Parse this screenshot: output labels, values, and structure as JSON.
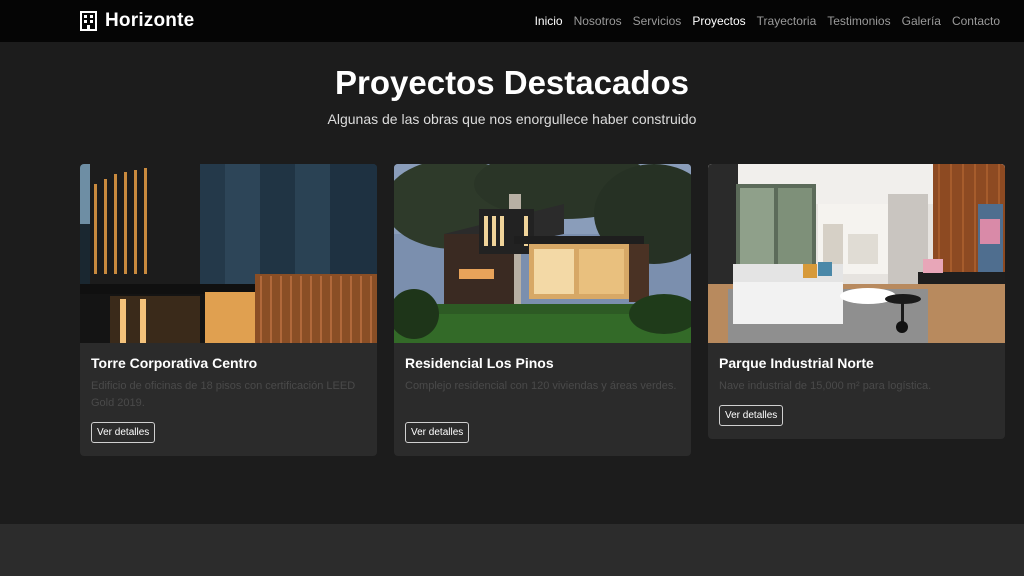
{
  "nav": {
    "brand": "Horizonte",
    "brand_icon": "building-icon",
    "links": [
      {
        "label": "Inicio",
        "state": "active"
      },
      {
        "label": "Nosotros",
        "state": ""
      },
      {
        "label": "Servicios",
        "state": ""
      },
      {
        "label": "Proyectos",
        "state": "current"
      },
      {
        "label": "Trayectoria",
        "state": ""
      },
      {
        "label": "Testimonios",
        "state": ""
      },
      {
        "label": "Galería",
        "state": ""
      },
      {
        "label": "Contacto",
        "state": ""
      }
    ]
  },
  "section": {
    "title": "Proyectos Destacados",
    "subtitle": "Algunas de las obras que nos enorgullece haber construido"
  },
  "cards": [
    {
      "title": "Torre Corporativa Centro",
      "description": "Edificio de oficinas de 18 pisos con certificación LEED Gold 2019.",
      "button": "Ver detalles",
      "image": "modern-office-building-night-photo"
    },
    {
      "title": "Residencial Los Pinos",
      "description": "Complejo residencial con 120 viviendas y áreas verdes.",
      "button": "Ver detalles",
      "image": "modern-house-garden-dusk-photo"
    },
    {
      "title": "Parque Industrial Norte",
      "description": "Nave industrial de 15,000 m² para logística.",
      "button": "Ver detalles",
      "image": "modern-living-room-interior-photo"
    }
  ],
  "colors": {
    "navbar_bg": "#050505",
    "section_bg": "#1c1c1c",
    "card_bg": "#2b2b2b",
    "footer_bg": "#2c2c2c",
    "text_primary": "#ffffff",
    "text_muted": "#9a9a9a"
  }
}
